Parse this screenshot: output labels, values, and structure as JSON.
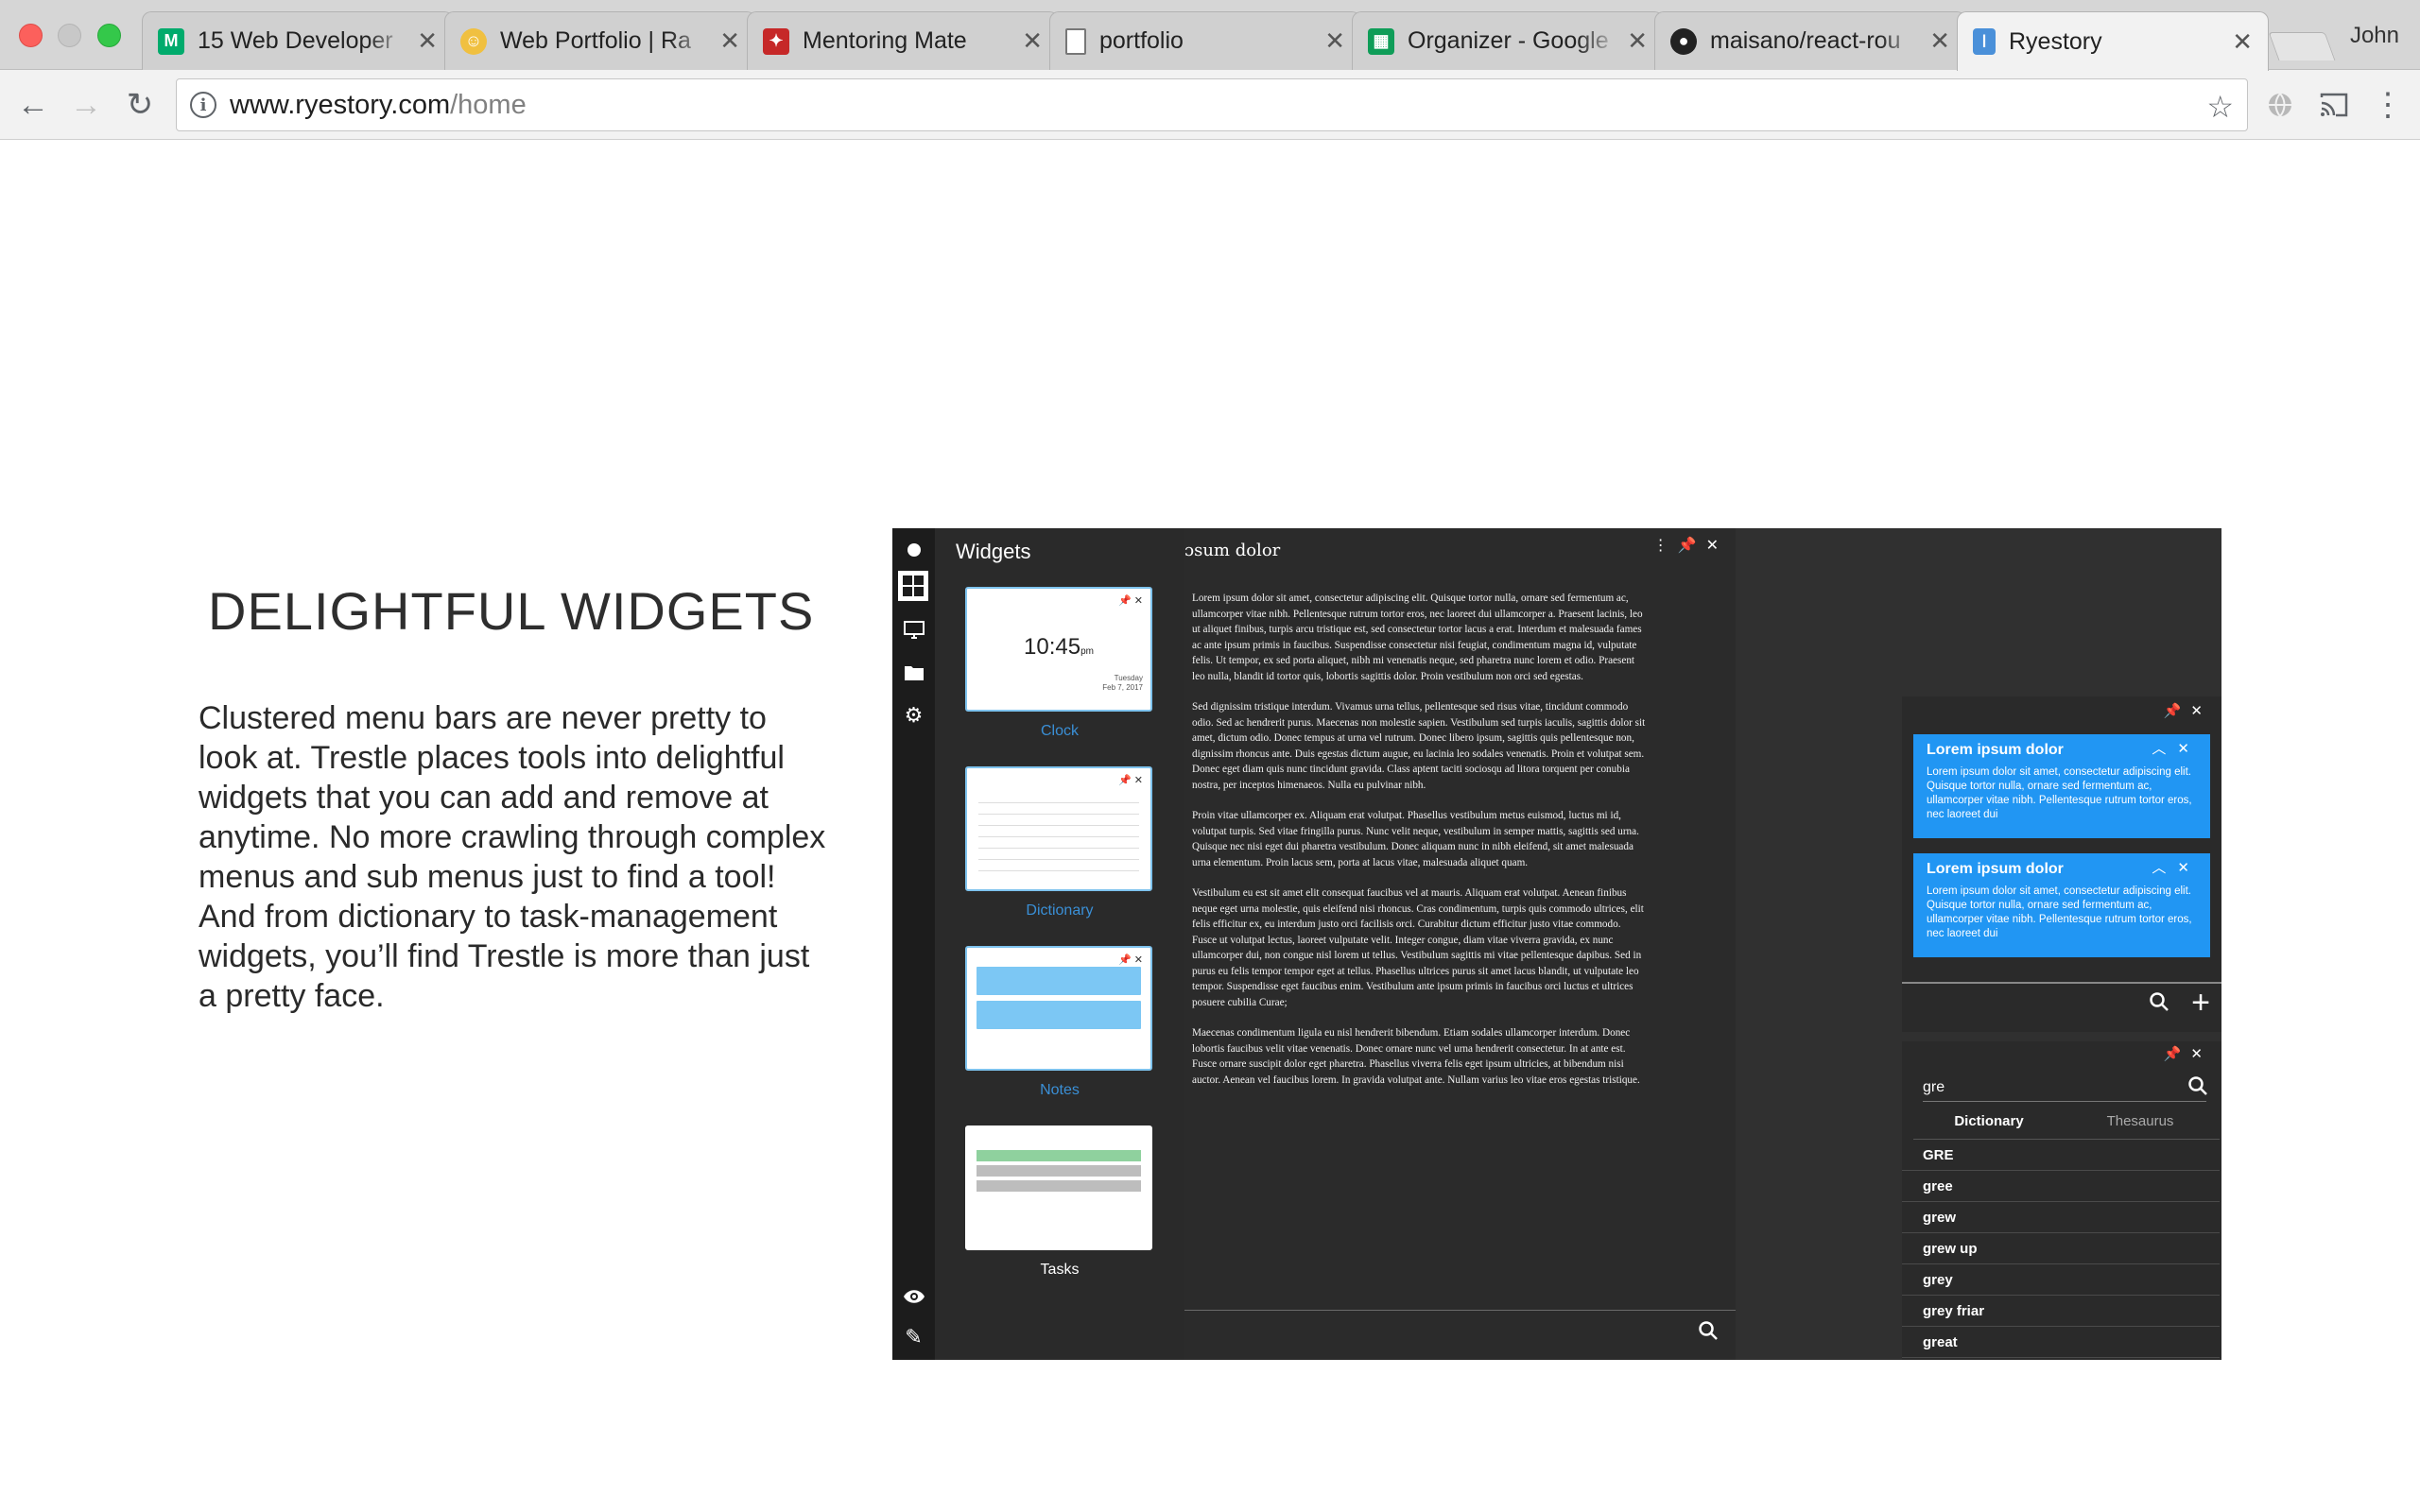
{
  "browser": {
    "tabs": [
      {
        "title": "15 Web Developer",
        "favicon": "medium-logo-icon",
        "color": "#00ab6c"
      },
      {
        "title": "Web Portfolio | Ra",
        "favicon": "portfolio-avatar-icon",
        "color": "#e0a030"
      },
      {
        "title": "Mentoring Mate",
        "favicon": "mentoring-mate-icon",
        "color": "#c62828"
      },
      {
        "title": "portfolio",
        "favicon": "document-icon",
        "color": "#888888"
      },
      {
        "title": "Organizer - Google",
        "favicon": "google-sheets-icon",
        "color": "#0f9d58"
      },
      {
        "title": "maisano/react-rou",
        "favicon": "github-icon",
        "color": "#222222"
      },
      {
        "title": "Ryestory",
        "favicon": "ryestory-icon",
        "color": "#4a90d9"
      }
    ],
    "active_tab_index": 6,
    "profile_name": "John",
    "url_host": "www.ryestory.com",
    "url_path": "/home"
  },
  "page": {
    "heading": "DELIGHTFUL WIDGETS",
    "description": "Clustered menu bars are never pretty to look at. Trestle places tools into delightful widgets that you can add and remove at anytime. No more crawling through complex menus and sub menus just to find a tool! And from dictionary to task-management widgets, you’ll find Trestle is more than just a pretty face."
  },
  "app": {
    "widgets_title": "Widgets",
    "widgets": [
      {
        "label": "Clock"
      },
      {
        "label": "Dictionary"
      },
      {
        "label": "Notes"
      },
      {
        "label": "Tasks"
      }
    ],
    "clock_time": "10:45",
    "clock_ampm": "pm",
    "clock_day": "Tuesday",
    "clock_date": "Feb 7, 2017",
    "doc_title": "ɔsum dolor",
    "doc_paragraphs": [
      "Lorem ipsum dolor sit amet, consectetur adipiscing elit. Quisque tortor nulla, ornare sed fermentum ac, ullamcorper vitae nibh. Pellentesque rutrum tortor eros, nec laoreet dui ullamcorper a. Praesent lacinis, leo ut aliquet finibus, turpis arcu tristique est, sed consectetur tortor lacus a erat. Interdum et malesuada fames ac ante ipsum primis in faucibus. Suspendisse consectetur nisi feugiat, condimentum magna id, vulputate felis. Ut tempor, ex sed porta aliquet, nibh mi venenatis neque, sed pharetra nunc lorem et odio. Praesent leo nulla, blandit id tortor quis, lobortis sagittis dolor. Proin vestibulum non orci sed egestas.",
      "Sed dignissim tristique interdum. Vivamus urna tellus, pellentesque sed risus vitae, tincidunt commodo odio. Sed ac hendrerit purus. Maecenas non molestie sapien. Vestibulum sed turpis iaculis, sagittis dolor sit amet, dictum odio. Donec tempus at urna vel rutrum. Donec libero ipsum, sagittis quis pellentesque non, dignissim rhoncus ante. Duis egestas dictum augue, eu lacinia leo sodales venenatis. Proin et volutpat sem. Donec eget diam quis nunc tincidunt gravida. Class aptent taciti sociosqu ad litora torquent per conubia nostra, per inceptos himenaeos. Nulla eu pulvinar nibh.",
      "Proin vitae ullamcorper ex. Aliquam erat volutpat. Phasellus vestibulum metus euismod, luctus mi id, volutpat turpis. Sed vitae fringilla purus. Nunc velit neque, vestibulum in semper mattis, sagittis sed urna. Quisque nec nisi eget dui pharetra vestibulum. Donec aliquam nunc in nibh eleifend, sit amet malesuada urna elementum. Proin lacus sem, porta at lacus vitae, malesuada aliquet quam.",
      "Vestibulum eu est sit amet elit consequat faucibus vel at mauris. Aliquam erat volutpat. Aenean finibus neque eget urna molestie, quis eleifend nisi rhoncus. Cras condimentum, turpis quis commodo ultrices, elit felis efficitur ex, eu interdum justo orci facilisis orci. Curabitur dictum efficitur justo vitae commodo. Fusce ut volutpat lectus, laoreet vulputate velit. Integer congue, diam vitae viverra gravida, ex nunc ullamcorper dui, non congue nisl lorem ut tellus. Vestibulum sagittis mi vitae pellentesque dapibus. Sed in purus eu felis tempor tempor eget at tellus. Phasellus ultrices purus sit amet lacus blandit, ut vulputate leo tempor. Suspendisse eget faucibus enim. Vestibulum ante ipsum primis in faucibus orci luctus et ultrices posuere cubilia Curae;",
      "Maecenas condimentum ligula eu nisl hendrerit bibendum. Etiam sodales ullamcorper interdum. Donec lobortis faucibus velit vitae venenatis. Donec ornare nunc vel urna hendrerit consectetur. In at ante est. Fusce ornare suscipit dolor eget pharetra. Phasellus viverra felis eget ipsum ultricies, at bibendum nisi auctor. Aenean vel faucibus lorem. In gravida volutpat ante. Nullam varius leo vitae eros egestas tristique."
    ],
    "notes": [
      {
        "title": "Lorem ipsum dolor",
        "body": "Lorem ipsum dolor sit amet, consectetur adipiscing elit. Quisque tortor nulla, ornare sed fermentum ac, ullamcorper vitae nibh. Pellentesque rutrum tortor eros, nec laoreet dui"
      },
      {
        "title": "Lorem ipsum dolor",
        "body": "Lorem ipsum dolor sit amet, consectetur adipiscing elit. Quisque tortor nulla, ornare sed fermentum ac, ullamcorper vitae nibh. Pellentesque rutrum tortor eros, nec laoreet dui"
      }
    ],
    "dict_query": "gre",
    "dict_tabs": [
      "Dictionary",
      "Thesaurus"
    ],
    "dict_results": [
      "GRE",
      "gree",
      "grew",
      "grew up",
      "grey",
      "grey friar",
      "great"
    ],
    "colors": {
      "note_blue": "#2196f3",
      "accent_blue": "#3a8fd6",
      "app_bg": "#303030"
    }
  }
}
